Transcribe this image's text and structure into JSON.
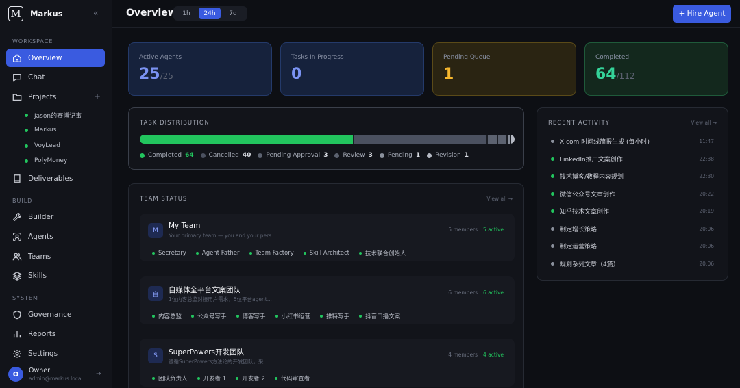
{
  "brand": {
    "logo": "M",
    "name": "Markus"
  },
  "sidebar": {
    "sections": {
      "workspace": "WORKSPACE",
      "build": "BUILD",
      "system": "SYSTEM"
    },
    "items": {
      "overview": "Overview",
      "chat": "Chat",
      "projects": "Projects",
      "deliverables": "Deliverables",
      "builder": "Builder",
      "agents": "Agents",
      "teams": "Teams",
      "skills": "Skills",
      "governance": "Governance",
      "reports": "Reports",
      "settings": "Settings"
    },
    "projects": [
      "Jason的赛博记事",
      "Markus",
      "VoyLead",
      "PolyMoney"
    ],
    "user": {
      "initial": "O",
      "name": "Owner",
      "email": "admin@markus.local"
    }
  },
  "header": {
    "title": "Overview",
    "ranges": [
      "1h",
      "24h",
      "7d"
    ],
    "active_range": "24h",
    "hire_label": "+ Hire Agent"
  },
  "stats": [
    {
      "label": "Active Agents",
      "value": "25",
      "total": "/25",
      "color": "#7b93f2"
    },
    {
      "label": "Tasks In Progress",
      "value": "0",
      "total": "",
      "color": "#7b93f2"
    },
    {
      "label": "Pending Queue",
      "value": "1",
      "total": "",
      "color": "#f5b62e"
    },
    {
      "label": "Completed",
      "value": "64",
      "total": "/112",
      "color": "#34d399"
    }
  ],
  "distribution": {
    "title": "TASK DISTRIBUTION",
    "items": [
      {
        "label": "Completed",
        "value": 64,
        "color": "#22c55e"
      },
      {
        "label": "Cancelled",
        "value": 40,
        "color": "#4b5160"
      },
      {
        "label": "Pending Approval",
        "value": 3,
        "color": "#5c6270"
      },
      {
        "label": "Review",
        "value": 3,
        "color": "#5c6270"
      },
      {
        "label": "Pending",
        "value": 1,
        "color": "#8a909c"
      },
      {
        "label": "Revision",
        "value": 1,
        "color": "#b5b9c3"
      }
    ]
  },
  "team_status": {
    "title": "TEAM STATUS",
    "view_all": "View all →",
    "teams": [
      {
        "initial": "M",
        "name": "My Team",
        "desc": "Your primary team — you and your pers...",
        "members": "5 members",
        "active": "5 active",
        "agents": [
          "Secretary",
          "Agent Father",
          "Team Factory",
          "Skill Architect",
          "技术联合创始人"
        ]
      },
      {
        "initial": "自",
        "name": "自媒体全平台文案团队",
        "desc": "1位内容总监对接用户需求，5位平台agent...",
        "members": "6 members",
        "active": "6 active",
        "agents": [
          "内容总监",
          "公众号写手",
          "博客写手",
          "小红书运营",
          "推特写手",
          "抖音口播文案"
        ]
      },
      {
        "initial": "S",
        "name": "SuperPowers开发团队",
        "desc": "遵循SuperPowers方法论的开发团队。采...",
        "members": "4 members",
        "active": "4 active",
        "agents": [
          "团队负责人",
          "开发者 1",
          "开发者 2",
          "代码审查者"
        ]
      }
    ]
  },
  "activity": {
    "title": "RECENT ACTIVITY",
    "view_all": "View all →",
    "items": [
      {
        "text": "X.com 时间线简报生成 (每小时)",
        "time": "11:47",
        "color": "#8a909c"
      },
      {
        "text": "LinkedIn推广文案创作",
        "time": "22:38",
        "color": "#22c55e"
      },
      {
        "text": "技术博客/教程内容规划",
        "time": "22:30",
        "color": "#22c55e"
      },
      {
        "text": "微信公众号文章创作",
        "time": "20:22",
        "color": "#22c55e"
      },
      {
        "text": "知乎技术文章创作",
        "time": "20:19",
        "color": "#22c55e"
      },
      {
        "text": "制定增长策略",
        "time": "20:06",
        "color": "#8a909c"
      },
      {
        "text": "制定运营策略",
        "time": "20:06",
        "color": "#8a909c"
      },
      {
        "text": "规划系列文章（4篇）",
        "time": "20:06",
        "color": "#8a909c"
      }
    ]
  }
}
